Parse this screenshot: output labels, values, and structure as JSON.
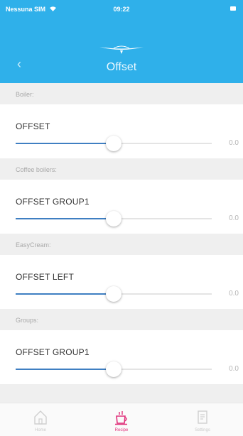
{
  "status_bar": {
    "carrier": "Nessuna SIM",
    "time": "09:22"
  },
  "header": {
    "title": "Offset",
    "back_icon": "chevron-left-icon",
    "logo_icon": "brand-logo-icon"
  },
  "sections": [
    {
      "heading": "Boiler:",
      "row": {
        "label": "OFFSET",
        "value": "0.0",
        "slider_fraction": 0.5
      }
    },
    {
      "heading": "Coffee boilers:",
      "row": {
        "label": "OFFSET GROUP1",
        "value": "0.0",
        "slider_fraction": 0.5
      }
    },
    {
      "heading": "EasyCream:",
      "row": {
        "label": "OFFSET LEFT",
        "value": "0.0",
        "slider_fraction": 0.5
      }
    },
    {
      "heading": "Groups:",
      "row": {
        "label": "OFFSET GROUP1",
        "value": "0.0",
        "slider_fraction": 0.5
      }
    }
  ],
  "tab_bar": {
    "tabs": [
      {
        "label": "Home",
        "icon": "home-icon",
        "active": false
      },
      {
        "label": "Recipe",
        "icon": "cup-icon",
        "active": true
      },
      {
        "label": "Settings",
        "icon": "document-icon",
        "active": false
      }
    ]
  },
  "colors": {
    "header": "#2fb0ea",
    "slider_fill": "#3f7fc2",
    "active_tab": "#e0307a",
    "section_bg": "#efefef"
  }
}
